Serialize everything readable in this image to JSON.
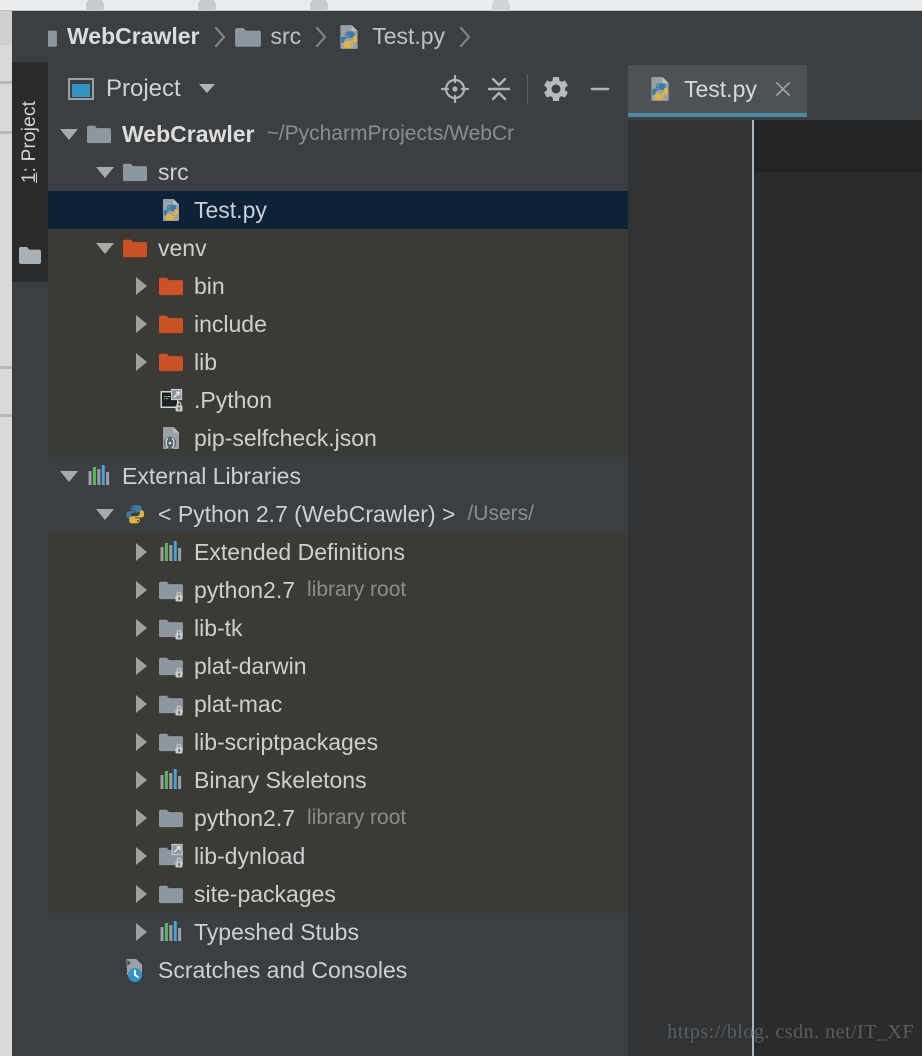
{
  "window": {
    "breadcrumb": [
      {
        "icon": "folder-icon",
        "label": "WebCrawler"
      },
      {
        "icon": "folder-icon",
        "label": "src"
      },
      {
        "icon": "python-file-icon",
        "label": "Test.py"
      }
    ]
  },
  "stripe": {
    "label_prefix": "1",
    "label_rest": ": Project",
    "folder_icon": "folder-icon"
  },
  "tool_window": {
    "icon": "project-window-icon",
    "title": "Project",
    "caret_icon": "chevron-down-icon",
    "actions": [
      {
        "name": "locate-icon",
        "tooltip": "Select Opened File"
      },
      {
        "name": "collapse-all-icon",
        "tooltip": "Collapse All"
      },
      {
        "name": "gear-icon",
        "tooltip": "Settings"
      },
      {
        "name": "minimize-icon",
        "tooltip": "Hide"
      }
    ]
  },
  "tabs": [
    {
      "icon": "python-file-icon",
      "label": "Test.py",
      "close_icon": "close-icon",
      "active": true
    }
  ],
  "tree": [
    {
      "depth": 0,
      "arrow": "down",
      "icon": "folder-gray",
      "label": "WebCrawler",
      "sub": "~/PycharmProjects/WebCr",
      "bold": true,
      "state": "normal"
    },
    {
      "depth": 1,
      "arrow": "down",
      "icon": "folder-gray",
      "label": "src",
      "sub": "",
      "bold": false,
      "state": "normal"
    },
    {
      "depth": 2,
      "arrow": "none",
      "icon": "python-file-icon",
      "label": "Test.py",
      "sub": "",
      "bold": false,
      "state": "selected"
    },
    {
      "depth": 1,
      "arrow": "down",
      "icon": "folder-orange",
      "label": "venv",
      "sub": "",
      "bold": false,
      "state": "tinted"
    },
    {
      "depth": 2,
      "arrow": "right",
      "icon": "folder-orange",
      "label": "bin",
      "sub": "",
      "bold": false,
      "state": "tinted"
    },
    {
      "depth": 2,
      "arrow": "right",
      "icon": "folder-orange",
      "label": "include",
      "sub": "",
      "bold": false,
      "state": "tinted"
    },
    {
      "depth": 2,
      "arrow": "right",
      "icon": "folder-orange",
      "label": "lib",
      "sub": "",
      "bold": false,
      "state": "tinted"
    },
    {
      "depth": 2,
      "arrow": "none",
      "icon": "terminal-lock-icon",
      "label": ".Python",
      "sub": "",
      "bold": false,
      "state": "tinted"
    },
    {
      "depth": 2,
      "arrow": "none",
      "icon": "json-file-icon",
      "label": "pip-selfcheck.json",
      "sub": "",
      "bold": false,
      "state": "tinted"
    },
    {
      "depth": 0,
      "arrow": "down",
      "icon": "library-bars-icon",
      "label": "External Libraries",
      "sub": "",
      "bold": false,
      "state": "normal"
    },
    {
      "depth": 1,
      "arrow": "down",
      "icon": "python-logo-icon",
      "label": "< Python 2.7 (WebCrawler) >",
      "sub": "/Users/",
      "bold": false,
      "state": "normal"
    },
    {
      "depth": 2,
      "arrow": "right",
      "icon": "library-bars-icon",
      "label": "Extended Definitions",
      "sub": "",
      "bold": false,
      "state": "tinted"
    },
    {
      "depth": 2,
      "arrow": "right",
      "icon": "folder-lock-icon",
      "label": "python2.7",
      "sub": "library root",
      "bold": false,
      "state": "tinted"
    },
    {
      "depth": 2,
      "arrow": "right",
      "icon": "folder-lock-icon",
      "label": "lib-tk",
      "sub": "",
      "bold": false,
      "state": "tinted"
    },
    {
      "depth": 2,
      "arrow": "right",
      "icon": "folder-lock-icon",
      "label": "plat-darwin",
      "sub": "",
      "bold": false,
      "state": "tinted"
    },
    {
      "depth": 2,
      "arrow": "right",
      "icon": "folder-lock-icon",
      "label": "plat-mac",
      "sub": "",
      "bold": false,
      "state": "tinted"
    },
    {
      "depth": 2,
      "arrow": "right",
      "icon": "folder-lock-icon",
      "label": "lib-scriptpackages",
      "sub": "",
      "bold": false,
      "state": "tinted"
    },
    {
      "depth": 2,
      "arrow": "right",
      "icon": "library-bars-icon",
      "label": "Binary Skeletons",
      "sub": "",
      "bold": false,
      "state": "tinted"
    },
    {
      "depth": 2,
      "arrow": "right",
      "icon": "folder-gray",
      "label": "python2.7",
      "sub": "library root",
      "bold": false,
      "state": "tinted"
    },
    {
      "depth": 2,
      "arrow": "right",
      "icon": "folder-link-lock",
      "label": "lib-dynload",
      "sub": "",
      "bold": false,
      "state": "tinted"
    },
    {
      "depth": 2,
      "arrow": "right",
      "icon": "folder-gray",
      "label": "site-packages",
      "sub": "",
      "bold": false,
      "state": "tinted"
    },
    {
      "depth": 2,
      "arrow": "right",
      "icon": "library-bars-icon",
      "label": "Typeshed Stubs",
      "sub": "",
      "bold": false,
      "state": "normal"
    },
    {
      "depth": 1,
      "arrow": "none",
      "icon": "scratches-icon",
      "label": "Scratches and Consoles",
      "sub": "",
      "bold": false,
      "state": "normal"
    }
  ],
  "watermark": {
    "text": "https://blog. csdn. net/IT_XF"
  },
  "colors": {
    "panel_bg": "#3c3f41",
    "editor_bg": "#2b2b2b",
    "selection_bg": "#0d2238",
    "library_tint_bg": "#3c3a34",
    "text": "#cdd0d2",
    "text_dim": "#8c8c8c",
    "folder_orange": "#cc5124",
    "folder_gray": "#8d97a0",
    "accent_blue": "#4a88a8",
    "python_blue": "#3a7cab",
    "python_yellow": "#e2b53d"
  }
}
